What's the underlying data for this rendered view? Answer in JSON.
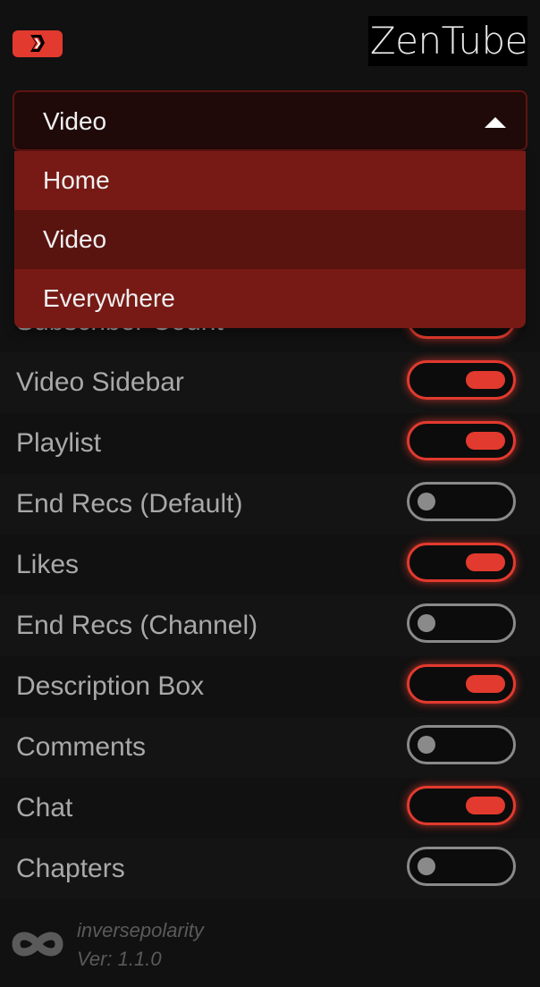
{
  "header": {
    "logo_icon": "zentube-logo-icon",
    "brand": "ZenTube",
    "accent_color": "#e23a2e"
  },
  "page_select": {
    "value": "Video",
    "expanded": true,
    "options": [
      "Home",
      "Video",
      "Everywhere"
    ],
    "selected_index": 1
  },
  "toggles": [
    {
      "label": "Subscriber Count",
      "on": true
    },
    {
      "label": "Video Sidebar",
      "on": true
    },
    {
      "label": "Playlist",
      "on": true
    },
    {
      "label": "End Recs (Default)",
      "on": false
    },
    {
      "label": "Likes",
      "on": true
    },
    {
      "label": "End Recs (Channel)",
      "on": false
    },
    {
      "label": "Description Box",
      "on": true
    },
    {
      "label": "Comments",
      "on": false
    },
    {
      "label": "Chat",
      "on": true
    },
    {
      "label": "Chapters",
      "on": false
    }
  ],
  "footer": {
    "icon": "infinity-icon",
    "author": "inversepolarity",
    "version": "Ver: 1.1.0"
  }
}
